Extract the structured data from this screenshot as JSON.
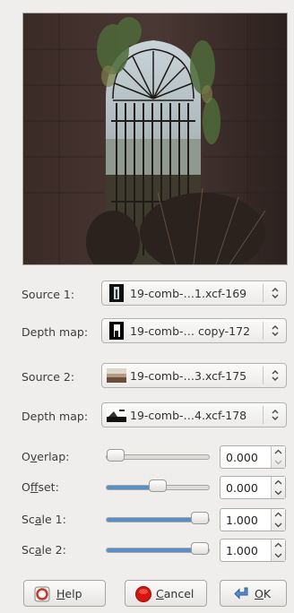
{
  "preview": {
    "icon": "arched-window-photo"
  },
  "source1": {
    "label_pre": "Source 1:",
    "value": "19-comb-…1.xcf-169"
  },
  "depth1": {
    "label_pre": "Depth map:",
    "value": "19-comb-… copy-172"
  },
  "source2": {
    "label_pre": "Source 2:",
    "value": "19-comb-…3.xcf-175"
  },
  "depth2": {
    "label_pre": "Depth map:",
    "value": "19-comb-…4.xcf-178"
  },
  "overlap": {
    "pre": "O",
    "mnemonic": "v",
    "post": "erlap:",
    "value": "0.000",
    "fraction": 0.0
  },
  "offset": {
    "pre": "O",
    "mnemonic": "f",
    "post": "fset:",
    "value": "0.000",
    "fraction": 0.5
  },
  "scale1": {
    "pre": "Sc",
    "mnemonic": "a",
    "post": "le 1:",
    "value": "1.000",
    "fraction": 1.0
  },
  "scale2": {
    "pre": "Sc",
    "mnemonic": "a",
    "post": "le 2:",
    "value": "1.000",
    "fraction": 1.0
  },
  "buttons": {
    "help": {
      "mnemonic": "H",
      "rest": "elp"
    },
    "cancel": {
      "mnemonic": "C",
      "rest": "ancel"
    },
    "ok": {
      "mnemonic": "O",
      "rest": "K"
    }
  },
  "colors": {
    "accent": "#5a8ec9",
    "cancel_red": "#d6140f",
    "help_red": "#c4392b",
    "ok_blue": "#3f73b3"
  }
}
